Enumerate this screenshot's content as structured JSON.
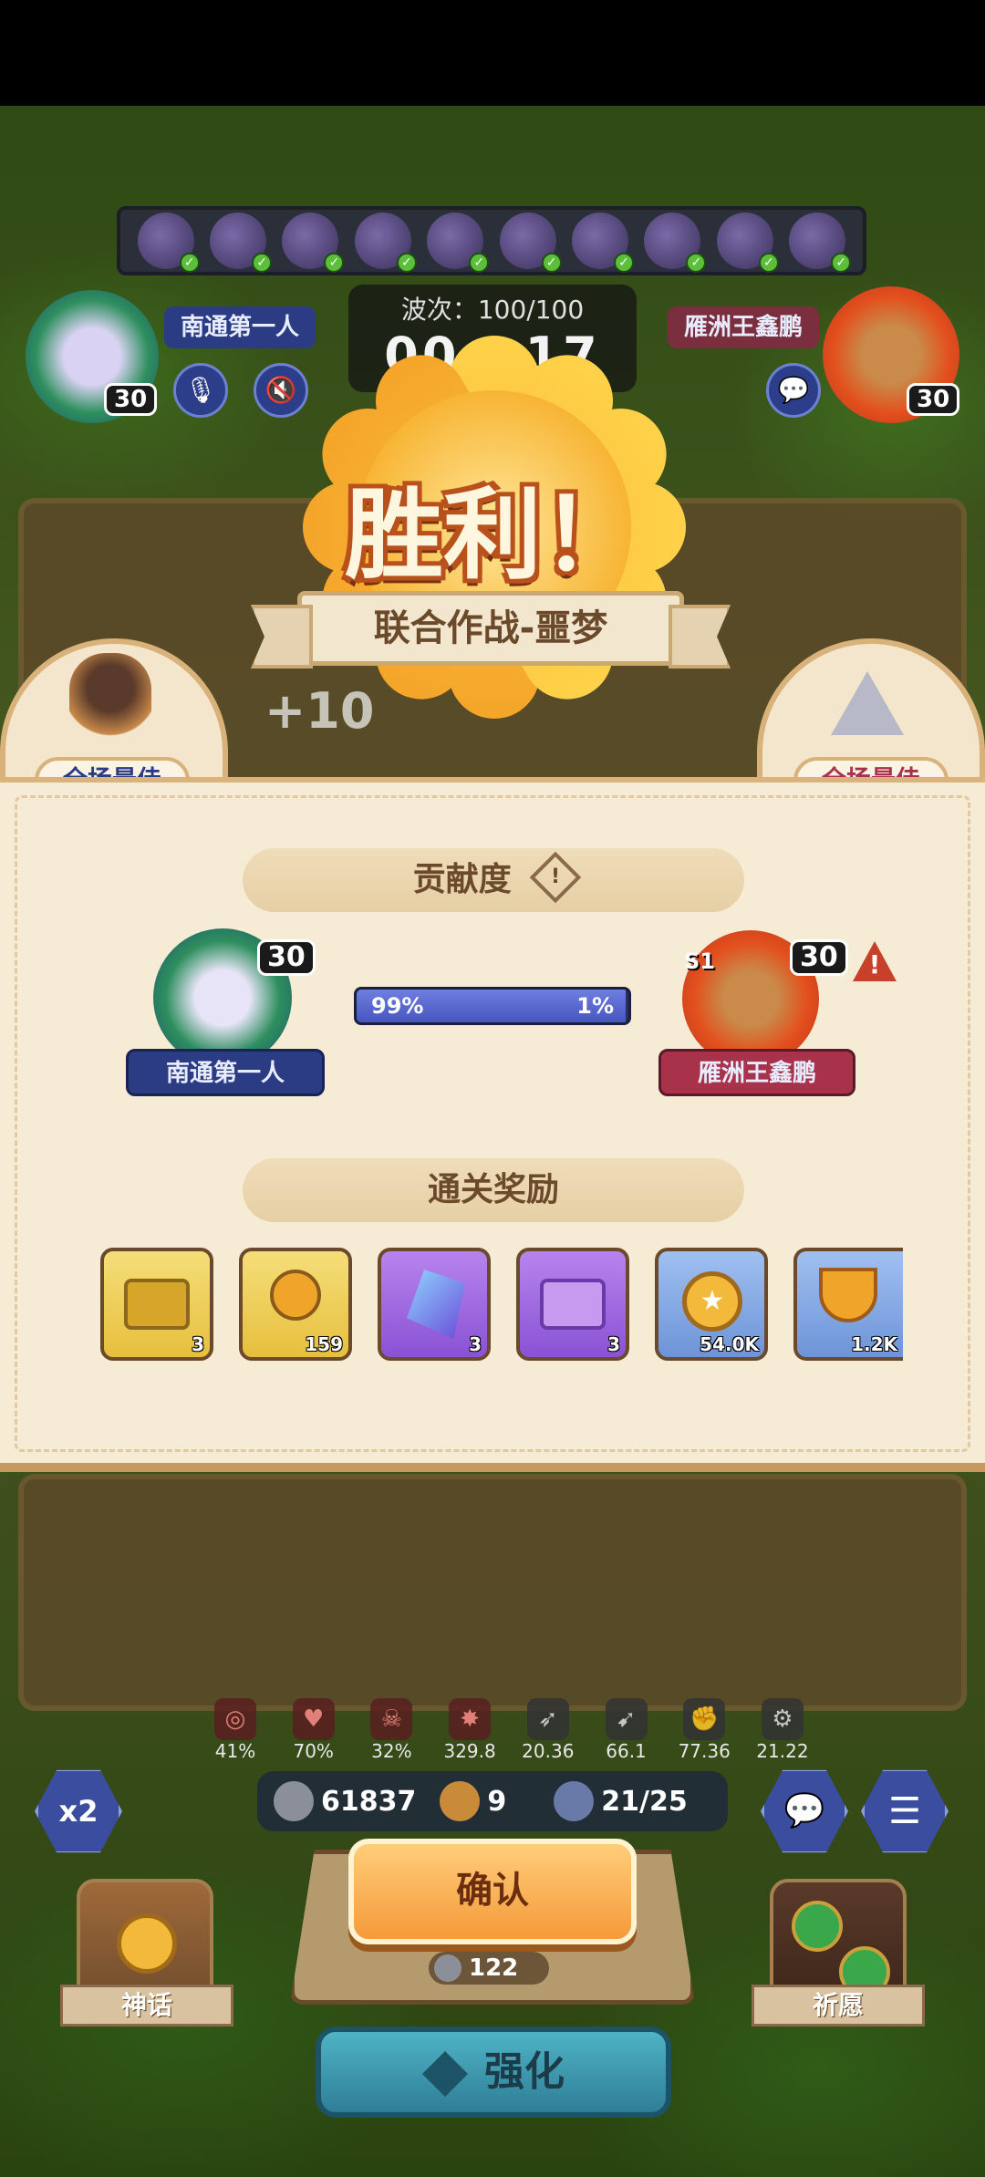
{
  "battle": {
    "wave_label": "波次：100/100",
    "timer": "00 : 17"
  },
  "player_left": {
    "name": "南通第一人",
    "level": "30"
  },
  "player_right": {
    "name": "雁洲王鑫鹏",
    "level": "30",
    "season_badge": "S1"
  },
  "result": {
    "title": "胜利！",
    "mode": "联合作战-噩梦",
    "bonus": "+10",
    "mvp_left": "全场最佳",
    "mvp_right": "全场最佳"
  },
  "contribution": {
    "heading": "贡献度",
    "info_icon": "!",
    "left_percent": "99%",
    "right_percent": "1%",
    "left_fraction": 0.99
  },
  "rewards": {
    "heading": "通关奖励",
    "items": [
      {
        "icon": "gold-chest-icon",
        "count": "3"
      },
      {
        "icon": "gold-key-icon",
        "count": "159"
      },
      {
        "icon": "crystal-icon",
        "count": "3"
      },
      {
        "icon": "purple-chest-icon",
        "count": "3"
      },
      {
        "icon": "gold-coin-icon",
        "count": "54.0K"
      },
      {
        "icon": "trophy-icon",
        "count": "1.2K"
      }
    ]
  },
  "stats": [
    "41%",
    "70%",
    "32%",
    "329.8",
    "20.36",
    "66.1",
    "77.36",
    "21.22"
  ],
  "resources": {
    "silver": "61837",
    "clover": "9",
    "units": "21/25"
  },
  "controls": {
    "speed": "x2",
    "confirm": "确认",
    "confirm_cost": "122",
    "mythic": "神话",
    "wish": "祈愿",
    "strengthen": "强化"
  },
  "colors": {
    "accent_orange": "#f59a3a",
    "panel_bg": "#f6ebd4",
    "progress_blue": "#4656c0"
  }
}
